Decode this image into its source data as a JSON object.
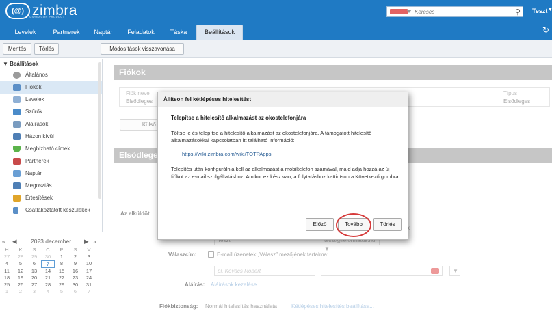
{
  "header": {
    "logo": "zimbra",
    "logo_sub": "A SYNACOR PRODUCT",
    "search_placeholder": "Keresés",
    "user": "Teszt"
  },
  "tabs": [
    "Levelek",
    "Partnerek",
    "Naptár",
    "Feladatok",
    "Táska",
    "Beállítások"
  ],
  "toolbar": {
    "save": "Mentés",
    "delete": "Törlés",
    "undo": "Módosítások visszavonása"
  },
  "sidebar": {
    "title": "Beállítások",
    "items": [
      {
        "label": "Általános",
        "icon": "gear-icon",
        "color": "#9b9b9b"
      },
      {
        "label": "Fiókok",
        "icon": "users-icon",
        "color": "#5b8fc7"
      },
      {
        "label": "Levelek",
        "icon": "mail-icon",
        "color": "#8fb0d5"
      },
      {
        "label": "Szűrők",
        "icon": "filter-icon",
        "color": "#4a8bc9"
      },
      {
        "label": "Aláírások",
        "icon": "signature-icon",
        "color": "#7a9cc0"
      },
      {
        "label": "Házon kívül",
        "icon": "away-icon",
        "color": "#4f7fb5"
      },
      {
        "label": "Megbízható címek",
        "icon": "shield-icon",
        "color": "#5bb34a"
      },
      {
        "label": "Partnerek",
        "icon": "contacts-icon",
        "color": "#c84a4a"
      },
      {
        "label": "Naptár",
        "icon": "calendar-icon",
        "color": "#6a9fd4"
      },
      {
        "label": "Megosztás",
        "icon": "share-icon",
        "color": "#4f7fb5"
      },
      {
        "label": "Értesítések",
        "icon": "bell-icon",
        "color": "#e0a52a"
      },
      {
        "label": "Csatlakoztatott készülékek",
        "icon": "device-icon",
        "color": "#5b8fc7"
      }
    ]
  },
  "calendar": {
    "title": "2023 december",
    "day_headers": [
      "H",
      "K",
      "S",
      "C",
      "P",
      "S",
      "V"
    ],
    "rows": [
      [
        "27",
        "28",
        "29",
        "30",
        "1",
        "2",
        "3"
      ],
      [
        "4",
        "5",
        "6",
        "7",
        "8",
        "9",
        "10"
      ],
      [
        "11",
        "12",
        "13",
        "14",
        "15",
        "16",
        "17"
      ],
      [
        "18",
        "19",
        "20",
        "21",
        "22",
        "23",
        "24"
      ],
      [
        "25",
        "26",
        "27",
        "28",
        "29",
        "30",
        "31"
      ],
      [
        "1",
        "2",
        "3",
        "4",
        "5",
        "6",
        "7"
      ]
    ]
  },
  "main": {
    "accounts_title": "Fiókok",
    "col_account_name": "Fiók neve",
    "col_type": "Típus",
    "row_account_name": "Elsődleges",
    "row_type": "Elsődleges",
    "external_button": "Külső fiók h",
    "primary_title": "Elsődlege",
    "sender_label": "Az elküldöt",
    "name_value": "Teszt",
    "email_value": "teszt@reformatus.hu",
    "reply_label": "Válaszcím:",
    "reply_checkbox": "E-mail üzenetek „Válasz” mezőjének tartalma:",
    "reply_name_placeholder": "pl. Kovács Róbert",
    "signature_label": "Aláírás:",
    "signature_link": "Aláírások kezelése ...",
    "security_label": "Fiókbiztonság:",
    "security_value": "Normál hitelesítés használata",
    "security_link": "Kétlépéses hitelesítés beállítása...",
    "right_k": "k"
  },
  "dialog": {
    "title": "Állítson fel kétlépéses hitelesítést",
    "heading": "Telepítse a hitelesítő alkalmazást az okostelefonjára",
    "para1": "Töltse le és telepítse a hitelesítő alkalmazást az okostelefonjára. A támogatott hitelesítő alkalmazásokkal kapcsolatban itt található információ:",
    "link": "https://wiki.zimbra.com/wiki/TOTPApps",
    "para2": "Telepítés után konfigurálnia kell az alkalmazást a mobiltelefon számával, majd adja hozzá az új fiókot az e-mail szolgáltatáshoz. Amikor ez kész van, a folytatáshoz kattintson a Következő gombra.",
    "btn_prev": "Előző",
    "btn_next": "Tovább",
    "btn_delete": "Törlés"
  },
  "colors": {
    "brand": "#1f7ac4",
    "highlight_circle": "#d63a3a"
  }
}
